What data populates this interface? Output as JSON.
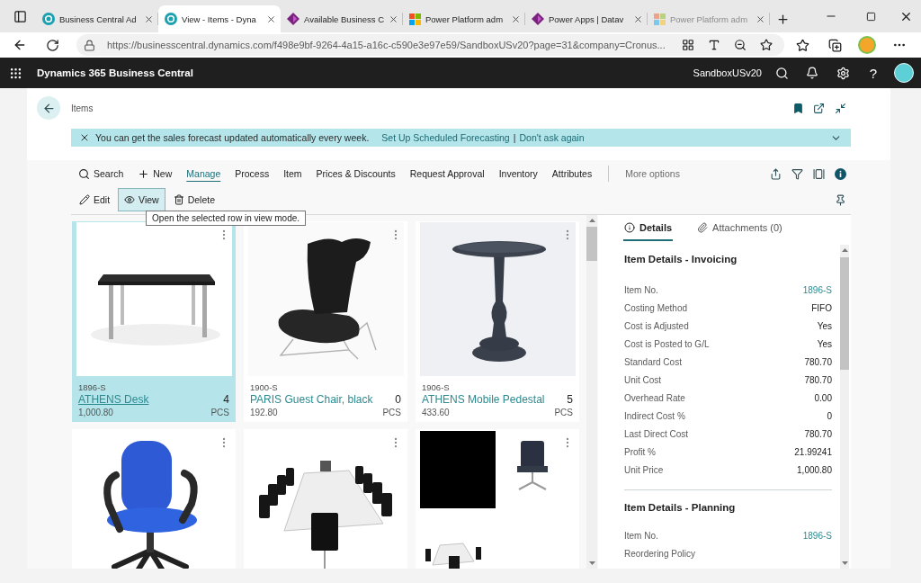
{
  "browser": {
    "tabs": [
      {
        "title": "Business Central Ad",
        "kind": "circle",
        "selected": false,
        "sleeping": false
      },
      {
        "title": "View - Items - Dyna",
        "kind": "circle",
        "selected": true,
        "sleeping": false
      },
      {
        "title": "Available Business C",
        "kind": "diamond",
        "selected": false,
        "sleeping": false
      },
      {
        "title": "Power Platform adm",
        "kind": "squares",
        "selected": false,
        "sleeping": false
      },
      {
        "title": "Power Apps | Datav",
        "kind": "diamond",
        "selected": false,
        "sleeping": false
      },
      {
        "title": "Power Platform adm",
        "kind": "squares",
        "selected": false,
        "sleeping": true
      }
    ],
    "url": "https://businesscentral.dynamics.com/f498e9bf-9264-4a15-a16c-c590e3e97e59/SandboxUSv20?page=31&company=Cronus..."
  },
  "app_bar": {
    "title": "Dynamics 365 Business Central",
    "environment": "SandboxUSv20",
    "help": "?"
  },
  "page": {
    "title": "Items"
  },
  "notification": {
    "message": "You can get the sales forecast updated automatically every week.",
    "links": [
      "Set Up Scheduled Forecasting",
      "Don't ask again"
    ],
    "separator": "|"
  },
  "actions": [
    {
      "label": "Search",
      "kind": "search",
      "selected": false
    },
    {
      "label": "New",
      "kind": "new",
      "selected": false
    },
    {
      "label": "Manage",
      "kind": "menu",
      "selected": true
    },
    {
      "label": "Process",
      "kind": "menu",
      "selected": false
    },
    {
      "label": "Item",
      "kind": "menu",
      "selected": false
    },
    {
      "label": "Prices & Discounts",
      "kind": "menu",
      "selected": false
    },
    {
      "label": "Request Approval",
      "kind": "menu",
      "selected": false
    },
    {
      "label": "Inventory",
      "kind": "menu",
      "selected": false
    },
    {
      "label": "Attributes",
      "kind": "menu",
      "selected": false
    },
    {
      "label": "More options",
      "kind": "more",
      "selected": false
    }
  ],
  "quick_actions": [
    {
      "label": "Edit",
      "kind": "edit",
      "hovered": false
    },
    {
      "label": "View",
      "kind": "view",
      "hovered": true
    },
    {
      "label": "Delete",
      "kind": "delete",
      "hovered": false
    }
  ],
  "tooltip": "Open the selected row in view mode.",
  "cards": [
    {
      "number": "1896-S",
      "name": "ATHENS Desk",
      "quantity": "4",
      "price": "1,000.80",
      "unit": "PCS",
      "kind": "desk",
      "selected": true
    },
    {
      "number": "1900-S",
      "name": "PARIS Guest Chair, black",
      "quantity": "0",
      "price": "192.80",
      "unit": "PCS",
      "kind": "lounge-chair",
      "selected": false
    },
    {
      "number": "1906-S",
      "name": "ATHENS Mobile Pedestal",
      "quantity": "5",
      "price": "433.60",
      "unit": "PCS",
      "kind": "pedestal-table",
      "selected": false
    },
    {
      "kind": "office-chair",
      "selected": false
    },
    {
      "kind": "conference-table",
      "selected": false
    },
    {
      "kind": "collage",
      "selected": false
    }
  ],
  "factbox": {
    "tabs": [
      {
        "label": "Details",
        "kind": "details",
        "selected": true
      },
      {
        "label": "Attachments (0)",
        "kind": "attachments",
        "selected": false
      }
    ],
    "sections": [
      {
        "title": "Item Details - Invoicing",
        "fields": [
          {
            "label": "Item No.",
            "link": "1896-S"
          },
          {
            "label": "Costing Method",
            "value": "FIFO"
          },
          {
            "label": "Cost is Adjusted",
            "value": "Yes"
          },
          {
            "label": "Cost is Posted to G/L",
            "value": "Yes"
          },
          {
            "label": "Standard Cost",
            "value": "780.70"
          },
          {
            "label": "Unit Cost",
            "value": "780.70"
          },
          {
            "label": "Overhead Rate",
            "value": "0.00"
          },
          {
            "label": "Indirect Cost %",
            "value": "0"
          },
          {
            "label": "Last Direct Cost",
            "value": "780.70"
          },
          {
            "label": "Profit %",
            "value": "21.99241"
          },
          {
            "label": "Unit Price",
            "value": "1,000.80"
          }
        ]
      },
      {
        "title": "Item Details - Planning",
        "fields": [
          {
            "label": "Item No.",
            "link": "1896-S"
          },
          {
            "label": "Reordering Policy"
          }
        ]
      }
    ]
  }
}
